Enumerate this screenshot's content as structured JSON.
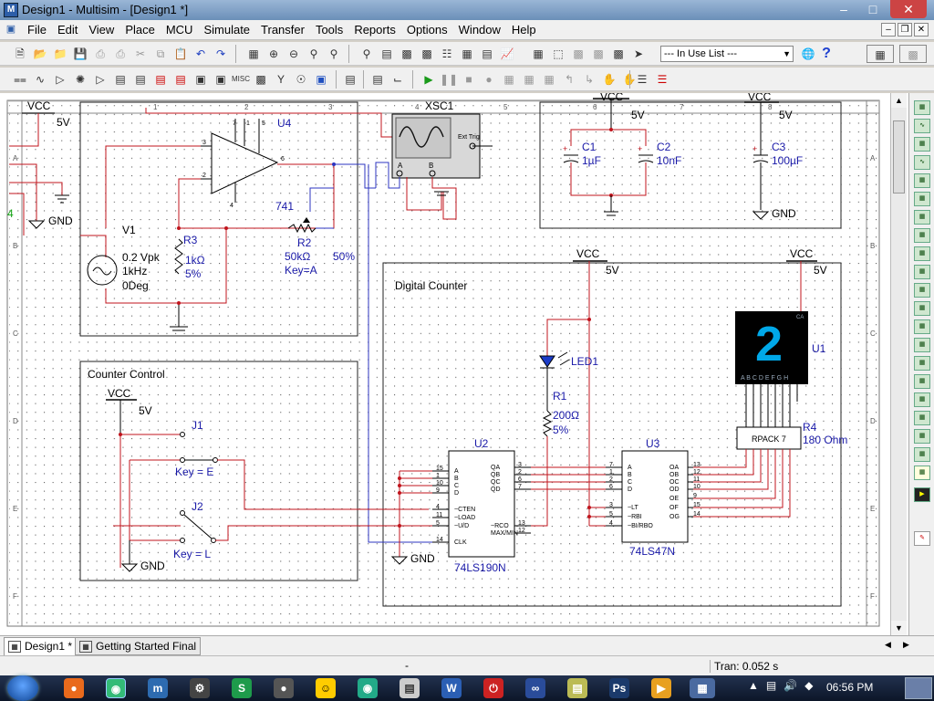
{
  "window": {
    "title": "Design1 - Multisim - [Design1 *]"
  },
  "menu": [
    "File",
    "Edit",
    "View",
    "Place",
    "MCU",
    "Simulate",
    "Transfer",
    "Tools",
    "Reports",
    "Options",
    "Window",
    "Help"
  ],
  "toolbar": {
    "in_use_list": "--- In Use List ---"
  },
  "schematic": {
    "border": {
      "cols": [
        "1",
        "2",
        "3",
        "4",
        "5",
        "6",
        "7",
        "8"
      ],
      "rows": [
        "A",
        "B",
        "C",
        "D",
        "E",
        "F"
      ]
    },
    "left_rail": {
      "vcc": "VCC",
      "vcc_v": "5V",
      "gnd": "GND",
      "node": "4"
    },
    "opamp": {
      "ref": "U4",
      "part": "741",
      "pin_labels": [
        "3",
        "2",
        "7",
        "1",
        "5",
        "6",
        "4"
      ]
    },
    "v1": {
      "ref": "V1",
      "amp": "0.2 Vpk",
      "freq": "1kHz",
      "phase": "0Deg"
    },
    "r3": {
      "ref": "R3",
      "value": "1kΩ",
      "tol": "5%"
    },
    "r2": {
      "ref": "R2",
      "value": "50kΩ",
      "key": "Key=A",
      "pct": "50%"
    },
    "scope": {
      "ref": "XSC1",
      "ext_trig": "Ext Trig",
      "ch_a": "A",
      "ch_b": "B"
    },
    "caps": {
      "vcc": "VCC",
      "vcc_v": "5V",
      "c1": "C1",
      "c1v": "1µF",
      "c2": "C2",
      "c2v": "10nF",
      "gnd": "GND",
      "vcc2": "VCC",
      "vcc2_v": "5V",
      "c3": "C3",
      "c3v": "100µF"
    },
    "counter_control": {
      "title": "Counter Control",
      "vcc": "VCC",
      "vcc_v": "5V",
      "j1": "J1",
      "key_e": "Key = E",
      "j2": "J2",
      "key_l": "Key = L",
      "gnd": "GND"
    },
    "digital_counter": {
      "title": "Digital Counter",
      "vcc1": "VCC",
      "vcc1_v": "5V",
      "vcc2": "VCC",
      "vcc2_v": "5V",
      "led": "LED1",
      "r1": "R1",
      "r1v": "200Ω",
      "r1t": "5%",
      "u1": "U1",
      "seg_digit": "2",
      "seg_letters": "A B C D E F G H",
      "seg_ca": "CA",
      "r4": "R4",
      "r4_box": "RPACK 7",
      "r4v": "180 Ohm",
      "u2": "U2",
      "u2_part": "74LS190N",
      "u2_left": [
        "A",
        "B",
        "C",
        "D",
        "~CTEN",
        "~LOAD",
        "~U/D",
        "CLK"
      ],
      "u2_right": [
        "QA",
        "QB",
        "QC",
        "QD",
        "~RCO",
        "MAX/MIN"
      ],
      "u2_leftnums": [
        "15",
        "1",
        "10",
        "9",
        "4",
        "11",
        "5",
        "14"
      ],
      "u2_rightnums": [
        "3",
        "2",
        "6",
        "7",
        "13",
        "12"
      ],
      "u3": "U3",
      "u3_part": "74LS47N",
      "u3_left": [
        "A",
        "B",
        "C",
        "D",
        "~LT",
        "~RBI",
        "~BI/RBO"
      ],
      "u3_right": [
        "OA",
        "OB",
        "OC",
        "OD",
        "OE",
        "OF",
        "OG"
      ],
      "u3_leftnums": [
        "7",
        "1",
        "2",
        "6",
        "3",
        "5",
        "4"
      ],
      "u3_rightnums": [
        "13",
        "12",
        "11",
        "10",
        "9",
        "15",
        "14"
      ],
      "gnd": "GND"
    }
  },
  "sheet_tabs": [
    "Design1 *",
    "Getting Started Final"
  ],
  "status": {
    "dash": "-",
    "tran": "Tran: 0.052 s"
  },
  "taskbar": {
    "clock": "06:56 PM"
  },
  "colors": {
    "wire_red": "#c0141c",
    "wire_blue": "#2c34c0",
    "label_blue": "#1a1aa8",
    "led_blue": "#1c3cc8",
    "seg_cyan": "#00a8e8"
  }
}
